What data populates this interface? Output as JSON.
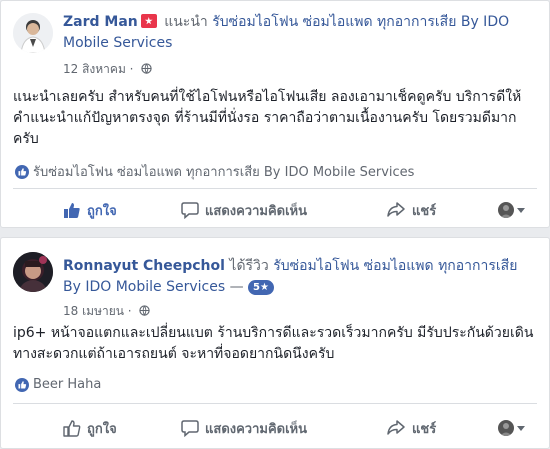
{
  "posts": [
    {
      "author": "Zard Man",
      "verb": "แนะนำ",
      "page": "รับซ่อมไอโฟน ซ่อมไอแพด ทุกอาการเสีย By IDO Mobile Services",
      "date": "12 สิงหาคม",
      "text": "แนะนำเลยครับ สำหรับคนที่ใช้ไอโฟนหรือไอโฟนเสีย ลองเอามาเช็คดูครับ บริการดีให้คำแนะนำแก้ปัญหาตรงจุด ที่ร้านมีที่นั่งรอ ราคาถือว่าตามเนื้องานครับ โดยรวมดีมากครับ",
      "recommend": "รับซ่อมไอโฟน ซ่อมไอแพด ทุกอาการเสีย By IDO Mobile Services",
      "actions": {
        "like": "ถูกใจ",
        "comment": "แสดงความคิดเห็น",
        "share": "แชร์"
      }
    },
    {
      "author": "Ronnayut Cheepchol",
      "verb": "ได้รีวิว",
      "page": "รับซ่อมไอโฟน ซ่อมไอแพด ทุกอาการเสีย By IDO Mobile Services",
      "separator": "—",
      "rating": "5★",
      "date": "18 เมษายน",
      "text": "ip6+ หน้าจอแตกและเปลี่ยนแบต ร้านบริการดีและรวดเร็วมากครับ มีรับประกันด้วยเดินทางสะดวกแต่ถ้าเอารถยนต์ จะหาที่จอดยากนิดนึงครับ",
      "likes": "Beer Haha",
      "actions": {
        "like": "ถูกใจ",
        "comment": "แสดงความคิดเห็น",
        "share": "แชร์"
      }
    }
  ],
  "colors": {
    "link": "#365899",
    "like_active": "#4267b2",
    "badge": "#e9354b",
    "muted": "#616770"
  }
}
